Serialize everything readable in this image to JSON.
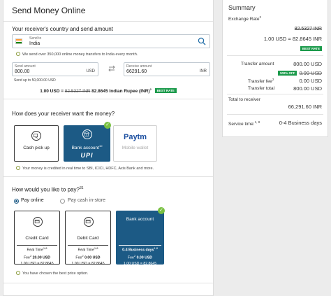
{
  "main": {
    "title": "Send Money Online",
    "country_section_label": "Your receiver's country and send amount",
    "country_caption": "Send to",
    "country_value": "India",
    "online_note": "We send over 350,000 online money transfers to India every month.",
    "send_field": {
      "caption": "Send amount",
      "value": "800.00",
      "currency": "USD"
    },
    "receive_field": {
      "caption": "Receive amount",
      "value": "66291.60",
      "currency": "INR"
    },
    "send_limit": "Send up to 50,000.00 USD",
    "rate": {
      "prefix": "1.00 USD = ",
      "old": "82.5327 INR",
      "new": "82.8645 Indian Rupee (INR)",
      "sup": "2",
      "badge": "BEST RATE"
    }
  },
  "receive": {
    "question": "How does your receiver want the money?",
    "options": [
      {
        "label": "Cash pick up"
      },
      {
        "label": "Bank account",
        "sup": "10",
        "logo": "UPI"
      },
      {
        "label": "Mobile wallet",
        "logo": "Paytm"
      }
    ],
    "note": "Your money is credited in real time to SBI, ICICI, HDFC, Axis Bank and more."
  },
  "pay": {
    "question": "How would you like to pay?",
    "question_sup": "31",
    "radio_online": "Pay online",
    "radio_store": "Pay cash in-store",
    "cards": [
      {
        "title": "Credit Card",
        "time": "Real Time",
        "time_sup": "1,8",
        "fee": "Fee",
        "fee_sup": "2",
        "fee_val": "20.00 USD",
        "rate": "1.00 USD = 82.8645"
      },
      {
        "title": "Debit Card",
        "time": "Real Time",
        "time_sup": "1,8",
        "fee": "Fee",
        "fee_sup": "2",
        "fee_val": "0.00 USD",
        "rate": "1.00 USD = 82.8645"
      },
      {
        "title": "Bank account",
        "time": "0-4 Business days",
        "time_sup": "1,8",
        "fee": "Fee",
        "fee_sup": "2",
        "fee_val": "0.00 USD",
        "rate": "1.00 USD = 82.8645"
      }
    ],
    "best_note": "You have chosen the best price option."
  },
  "summary": {
    "title": "Summary",
    "exchange_label": "Exchange Rate",
    "exchange_sup": "2",
    "exchange_old": "82.5327 INR",
    "exchange_new": "1.00 USD = 82.8645 INR",
    "exchange_badge": "BEST RATE",
    "transfer_amount_label": "Transfer amount",
    "transfer_amount_value": "800.00 USD",
    "off_badge": "100% OFF",
    "fee_old": "0.99 USD",
    "transfer_fee_label": "Transfer fee",
    "transfer_fee_sup": "2",
    "transfer_fee_value": "0.00 USD",
    "transfer_total_label": "Transfer total",
    "transfer_total_value": "800.00 USD",
    "total_receiver_label": "Total  to receiver",
    "total_receiver_value": "66,291.60 INR",
    "service_time_label": "Service time:",
    "service_time_sup": "1, 8",
    "service_time_value": "0-4 Business days"
  },
  "colors": {
    "brand": "#1c5a85",
    "best": "#1b9a4b",
    "check": "#7ac142"
  }
}
